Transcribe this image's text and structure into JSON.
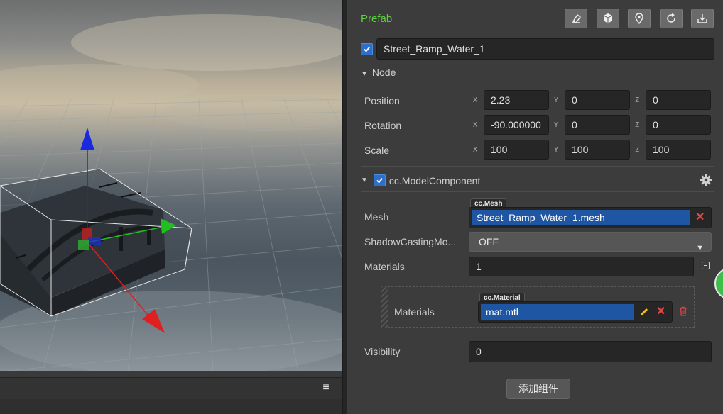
{
  "inspector": {
    "prefab_label": "Prefab",
    "node_name": "Street_Ramp_Water_1",
    "node_section": "Node",
    "position": {
      "label": "Position",
      "x": "2.23",
      "y": "0",
      "z": "0"
    },
    "rotation": {
      "label": "Rotation",
      "x": "-90.000000",
      "y": "0",
      "z": "0"
    },
    "scale": {
      "label": "Scale",
      "x": "100",
      "y": "100",
      "z": "100"
    },
    "axes": {
      "x": "X",
      "y": "Y",
      "z": "Z"
    },
    "component": {
      "title": "cc.ModelComponent",
      "mesh_label": "Mesh",
      "mesh_type": "cc.Mesh",
      "mesh_value": "Street_Ramp_Water_1.mesh",
      "shadow_label": "ShadowCastingMo...",
      "shadow_value": "OFF",
      "materials_label": "Materials",
      "materials_count": "1",
      "material_item_label": "Materials",
      "material_type": "cc.Material",
      "material_value": "mat.mtl",
      "visibility_label": "Visibility",
      "visibility_value": "0"
    },
    "add_component_button": "添加组件"
  },
  "toolbar_icons": [
    "eraser-icon",
    "cube-icon",
    "location-pin-icon",
    "refresh-icon",
    "save-down-icon"
  ],
  "colors": {
    "prefab_label": "#5bd33a",
    "asset_selection": "#1f56a3",
    "remove_icon": "#e04848",
    "edit_icon": "#f5c518",
    "gizmo_x": "#e02020",
    "gizmo_y": "#20c020",
    "gizmo_z": "#1a28e0"
  }
}
